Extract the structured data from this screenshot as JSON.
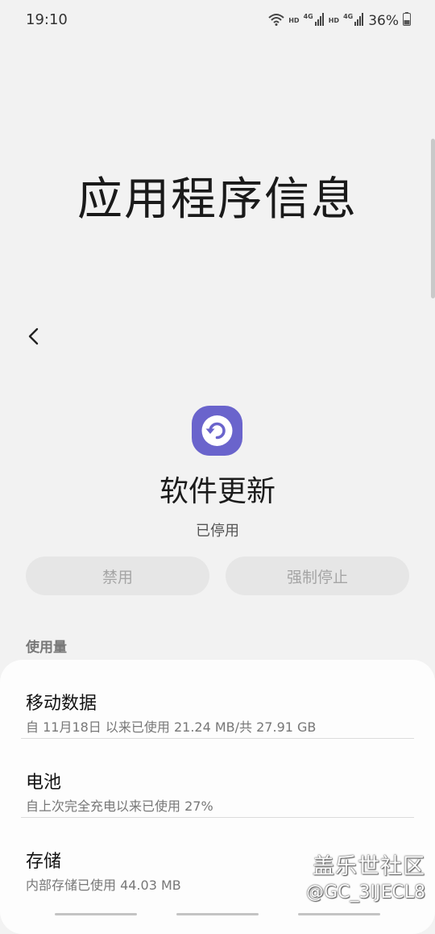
{
  "status_bar": {
    "time": "19:10",
    "hd_1": "HD",
    "net_1": "4G",
    "hd_2": "HD",
    "net_2": "4G",
    "battery_percent": "36%"
  },
  "page": {
    "title": "应用程序信息"
  },
  "app": {
    "name": "软件更新",
    "status": "已停用",
    "icon": "software-update-icon",
    "icon_color": "#6a64cc"
  },
  "actions": {
    "disable_label": "禁用",
    "force_stop_label": "强制停止"
  },
  "usage": {
    "header": "使用量",
    "items": [
      {
        "title": "移动数据",
        "subtitle": "自 11月18日 以来已使用 21.24 MB/共 27.91 GB"
      },
      {
        "title": "电池",
        "subtitle": "自上次完全充电以来已使用 27%"
      },
      {
        "title": "存储",
        "subtitle": "内部存储已使用 44.03 MB"
      }
    ]
  },
  "watermark": {
    "community": "盖乐世社区",
    "user": "@GC_3IJECL8"
  }
}
